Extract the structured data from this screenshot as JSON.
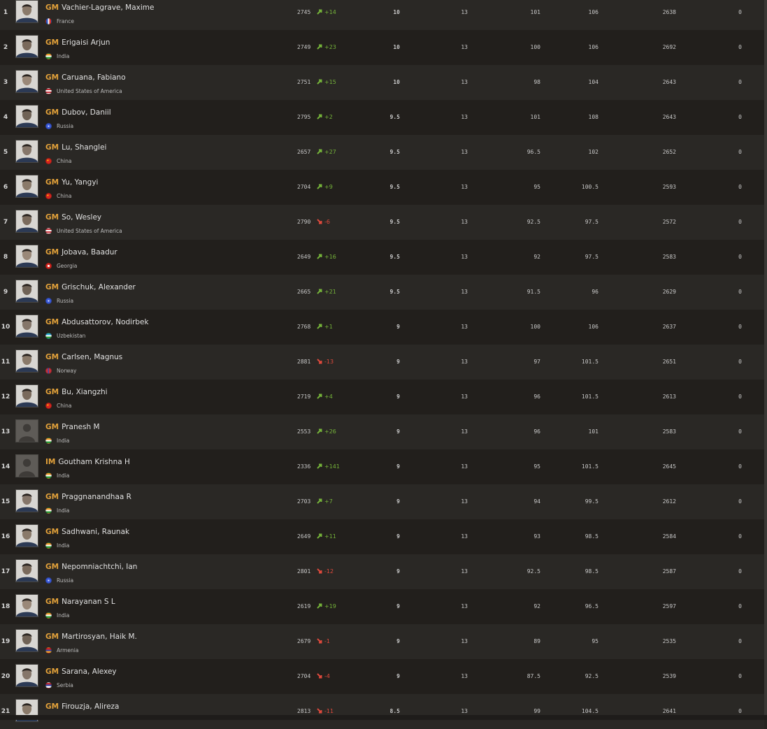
{
  "colors": {
    "title": "#e2a13a",
    "up": "#75b33a",
    "down": "#e04a3d",
    "row_odd": "#2a2825",
    "row_even": "#221f1c"
  },
  "standings": [
    {
      "rank": "1",
      "title": "GM",
      "name": "Vachier-Lagrave, Maxime",
      "country": "France",
      "flag": "flag-france",
      "rating": "2745",
      "dir": "up",
      "change": "+14",
      "points": "10",
      "games": "13",
      "bh1": "101",
      "bh2": "106",
      "perf": "2638",
      "extra": "0",
      "avatar": "photo"
    },
    {
      "rank": "2",
      "title": "GM",
      "name": "Erigaisi Arjun",
      "country": "India",
      "flag": "flag-india",
      "rating": "2749",
      "dir": "up",
      "change": "+23",
      "points": "10",
      "games": "13",
      "bh1": "100",
      "bh2": "106",
      "perf": "2692",
      "extra": "0",
      "avatar": "photo"
    },
    {
      "rank": "3",
      "title": "GM",
      "name": "Caruana, Fabiano",
      "country": "United States of America",
      "flag": "flag-usa",
      "rating": "2751",
      "dir": "up",
      "change": "+15",
      "points": "10",
      "games": "13",
      "bh1": "98",
      "bh2": "104",
      "perf": "2643",
      "extra": "0",
      "avatar": "photo"
    },
    {
      "rank": "4",
      "title": "GM",
      "name": "Dubov, Daniil",
      "country": "Russia",
      "flag": "flag-russia",
      "rating": "2795",
      "dir": "up",
      "change": "+2",
      "points": "9.5",
      "games": "13",
      "bh1": "101",
      "bh2": "108",
      "perf": "2643",
      "extra": "0",
      "avatar": "photo"
    },
    {
      "rank": "5",
      "title": "GM",
      "name": "Lu, Shanglei",
      "country": "China",
      "flag": "flag-china",
      "rating": "2657",
      "dir": "up",
      "change": "+27",
      "points": "9.5",
      "games": "13",
      "bh1": "96.5",
      "bh2": "102",
      "perf": "2652",
      "extra": "0",
      "avatar": "photo"
    },
    {
      "rank": "6",
      "title": "GM",
      "name": "Yu, Yangyi",
      "country": "China",
      "flag": "flag-china",
      "rating": "2704",
      "dir": "up",
      "change": "+9",
      "points": "9.5",
      "games": "13",
      "bh1": "95",
      "bh2": "100.5",
      "perf": "2593",
      "extra": "0",
      "avatar": "photo"
    },
    {
      "rank": "7",
      "title": "GM",
      "name": "So, Wesley",
      "country": "United States of America",
      "flag": "flag-usa",
      "rating": "2790",
      "dir": "down",
      "change": "-6",
      "points": "9.5",
      "games": "13",
      "bh1": "92.5",
      "bh2": "97.5",
      "perf": "2572",
      "extra": "0",
      "avatar": "photo"
    },
    {
      "rank": "8",
      "title": "GM",
      "name": "Jobava, Baadur",
      "country": "Georgia",
      "flag": "flag-georgia",
      "rating": "2649",
      "dir": "up",
      "change": "+16",
      "points": "9.5",
      "games": "13",
      "bh1": "92",
      "bh2": "97.5",
      "perf": "2583",
      "extra": "0",
      "avatar": "photo"
    },
    {
      "rank": "9",
      "title": "GM",
      "name": "Grischuk, Alexander",
      "country": "Russia",
      "flag": "flag-russia",
      "rating": "2665",
      "dir": "up",
      "change": "+21",
      "points": "9.5",
      "games": "13",
      "bh1": "91.5",
      "bh2": "96",
      "perf": "2629",
      "extra": "0",
      "avatar": "photo"
    },
    {
      "rank": "10",
      "title": "GM",
      "name": "Abdusattorov, Nodirbek",
      "country": "Uzbekistan",
      "flag": "flag-uzbekistan",
      "rating": "2768",
      "dir": "up",
      "change": "+1",
      "points": "9",
      "games": "13",
      "bh1": "100",
      "bh2": "106",
      "perf": "2637",
      "extra": "0",
      "avatar": "photo"
    },
    {
      "rank": "11",
      "title": "GM",
      "name": "Carlsen, Magnus",
      "country": "Norway",
      "flag": "flag-norway",
      "rating": "2881",
      "dir": "down",
      "change": "-13",
      "points": "9",
      "games": "13",
      "bh1": "97",
      "bh2": "101.5",
      "perf": "2651",
      "extra": "0",
      "avatar": "photo"
    },
    {
      "rank": "12",
      "title": "GM",
      "name": "Bu, Xiangzhi",
      "country": "China",
      "flag": "flag-china",
      "rating": "2719",
      "dir": "up",
      "change": "+4",
      "points": "9",
      "games": "13",
      "bh1": "96",
      "bh2": "101.5",
      "perf": "2613",
      "extra": "0",
      "avatar": "photo"
    },
    {
      "rank": "13",
      "title": "GM",
      "name": "Pranesh M",
      "country": "India",
      "flag": "flag-india",
      "rating": "2553",
      "dir": "up",
      "change": "+26",
      "points": "9",
      "games": "13",
      "bh1": "96",
      "bh2": "101",
      "perf": "2583",
      "extra": "0",
      "avatar": "placeholder"
    },
    {
      "rank": "14",
      "title": "IM",
      "name": "Goutham Krishna H",
      "country": "India",
      "flag": "flag-india",
      "rating": "2336",
      "dir": "up",
      "change": "+141",
      "points": "9",
      "games": "13",
      "bh1": "95",
      "bh2": "101.5",
      "perf": "2645",
      "extra": "0",
      "avatar": "placeholder"
    },
    {
      "rank": "15",
      "title": "GM",
      "name": "Praggnanandhaa R",
      "country": "India",
      "flag": "flag-india",
      "rating": "2703",
      "dir": "up",
      "change": "+7",
      "points": "9",
      "games": "13",
      "bh1": "94",
      "bh2": "99.5",
      "perf": "2612",
      "extra": "0",
      "avatar": "photo"
    },
    {
      "rank": "16",
      "title": "GM",
      "name": "Sadhwani, Raunak",
      "country": "India",
      "flag": "flag-india",
      "rating": "2649",
      "dir": "up",
      "change": "+11",
      "points": "9",
      "games": "13",
      "bh1": "93",
      "bh2": "98.5",
      "perf": "2584",
      "extra": "0",
      "avatar": "photo"
    },
    {
      "rank": "17",
      "title": "GM",
      "name": "Nepomniachtchi, Ian",
      "country": "Russia",
      "flag": "flag-russia",
      "rating": "2801",
      "dir": "down",
      "change": "-12",
      "points": "9",
      "games": "13",
      "bh1": "92.5",
      "bh2": "98.5",
      "perf": "2587",
      "extra": "0",
      "avatar": "photo"
    },
    {
      "rank": "18",
      "title": "GM",
      "name": "Narayanan S L",
      "country": "India",
      "flag": "flag-india",
      "rating": "2619",
      "dir": "up",
      "change": "+19",
      "points": "9",
      "games": "13",
      "bh1": "92",
      "bh2": "96.5",
      "perf": "2597",
      "extra": "0",
      "avatar": "photo"
    },
    {
      "rank": "19",
      "title": "GM",
      "name": "Martirosyan, Haik M.",
      "country": "Armenia",
      "flag": "flag-armenia",
      "rating": "2679",
      "dir": "down",
      "change": "-1",
      "points": "9",
      "games": "13",
      "bh1": "89",
      "bh2": "95",
      "perf": "2535",
      "extra": "0",
      "avatar": "photo"
    },
    {
      "rank": "20",
      "title": "GM",
      "name": "Sarana, Alexey",
      "country": "Serbia",
      "flag": "flag-serbia",
      "rating": "2704",
      "dir": "down",
      "change": "-4",
      "points": "9",
      "games": "13",
      "bh1": "87.5",
      "bh2": "92.5",
      "perf": "2539",
      "extra": "0",
      "avatar": "photo"
    },
    {
      "rank": "21",
      "title": "GM",
      "name": "Firouzja, Alireza",
      "country": "",
      "flag": "",
      "rating": "2813",
      "dir": "down",
      "change": "-11",
      "points": "8.5",
      "games": "13",
      "bh1": "99",
      "bh2": "104.5",
      "perf": "2641",
      "extra": "0",
      "avatar": "photo"
    }
  ]
}
